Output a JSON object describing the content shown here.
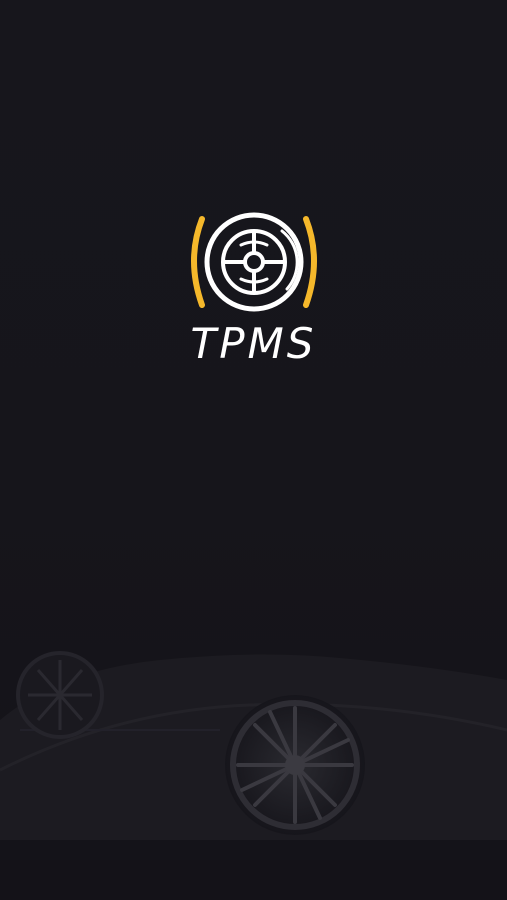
{
  "splash": {
    "app_name": "TPMS",
    "logo_icon": "tire-pressure-icon",
    "background_image": "dark-car-wheel-photo"
  },
  "colors": {
    "background": "#16151b",
    "accent": "#f5b82b",
    "logo_stroke": "#ffffff",
    "text": "#ffffff"
  }
}
